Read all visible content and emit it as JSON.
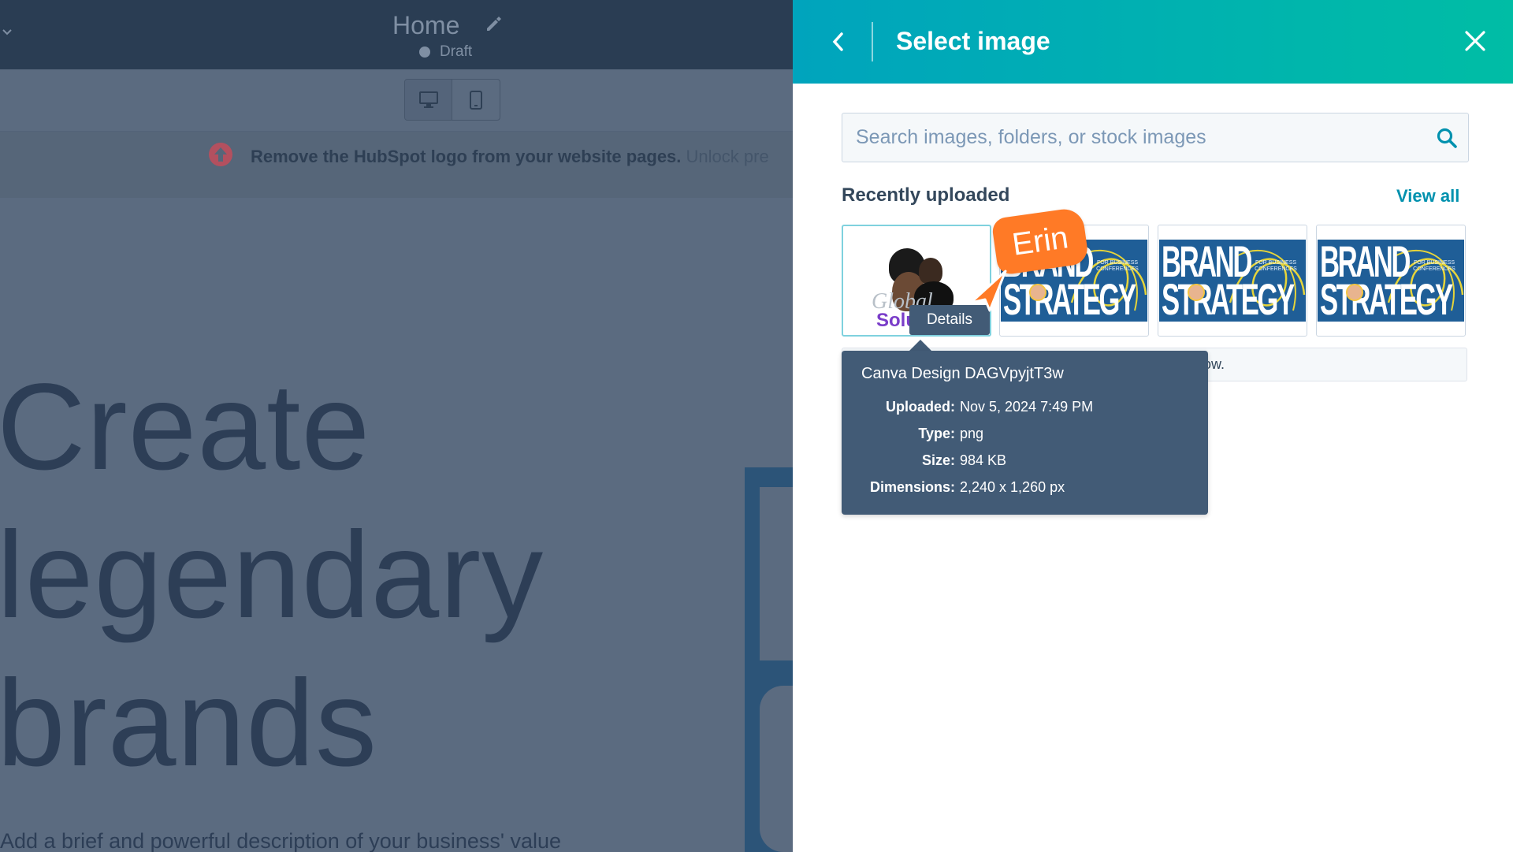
{
  "editor": {
    "page_name": "Home",
    "status": "Draft",
    "upgrade_bold": "Remove the HubSpot logo from your website pages.",
    "upgrade_rest": " Unlock pre",
    "hero_line1": "Create",
    "hero_line2": "legendary",
    "hero_line3": "brands",
    "hero_description": "Add a brief and powerful description of your business' value"
  },
  "panel": {
    "title": "Select image",
    "search_placeholder": "Search images, folders, or stock images",
    "section_title": "Recently uploaded",
    "view_all": "View all",
    "thumbnails": [
      {
        "text_1": "Global",
        "text_2": "Solu"
      },
      {
        "word_1": "BRAND",
        "word_2": "STRATEGY",
        "caption": "FOR BUSINESS CONFERENCES"
      },
      {
        "word_1": "BRAND",
        "word_2": "STRATEGY",
        "caption": "FOR BUSINESS CONFERENCES"
      },
      {
        "word_1": "BRAND",
        "word_2": "STRATEGY",
        "caption": "FOR BUSINESS CONFERENCES"
      }
    ],
    "details_label": "Details",
    "hidden_row_text": "ow.",
    "tooltip": {
      "title": "Canva Design DAGVpyjtT3w",
      "uploaded_label": "Uploaded:",
      "uploaded_value": "Nov 5, 2024 7:49 PM",
      "type_label": "Type:",
      "type_value": "png",
      "size_label": "Size:",
      "size_value": "984 KB",
      "dimensions_label": "Dimensions:",
      "dimensions_value": "2,240 x 1,260 px"
    }
  },
  "cursor": {
    "name": "Erin",
    "color": "#ff7a26"
  },
  "colors": {
    "header_gradient_start": "#00a4bd",
    "header_gradient_end": "#00bda5",
    "link": "#0091ae",
    "tooltip_bg": "#425b76",
    "editor_overlay": "#5b6b80"
  }
}
